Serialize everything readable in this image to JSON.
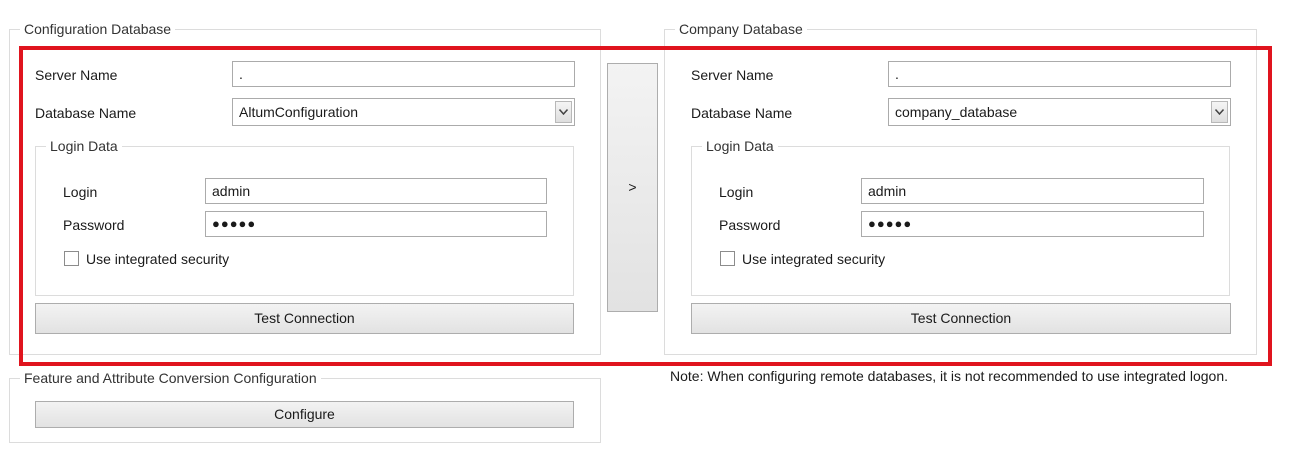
{
  "config_db": {
    "title": "Configuration Database",
    "server_label": "Server Name",
    "server_value": ".",
    "database_label": "Database Name",
    "database_value": "AltumConfiguration",
    "login_group_title": "Login Data",
    "login_label": "Login",
    "login_value": "admin",
    "password_label": "Password",
    "password_value": "●●●●●",
    "integrated_label": "Use integrated security",
    "integrated_checked": false,
    "test_button": "Test Connection"
  },
  "copy_button": ">",
  "company_db": {
    "title": "Company Database",
    "server_label": "Server Name",
    "server_value": ".",
    "database_label": "Database Name",
    "database_value": "company_database",
    "login_group_title": "Login Data",
    "login_label": "Login",
    "login_value": "admin",
    "password_label": "Password",
    "password_value": "●●●●●",
    "integrated_label": "Use integrated security",
    "integrated_checked": false,
    "test_button": "Test Connection"
  },
  "feature_config": {
    "title": "Feature and Attribute Conversion Configuration",
    "configure_button": "Configure"
  },
  "note": "Note: When configuring remote databases, it is not recommended to use integrated logon.",
  "icons": {
    "dropdown": "chevron-down-icon"
  },
  "colors": {
    "highlight": "#e0141e"
  }
}
